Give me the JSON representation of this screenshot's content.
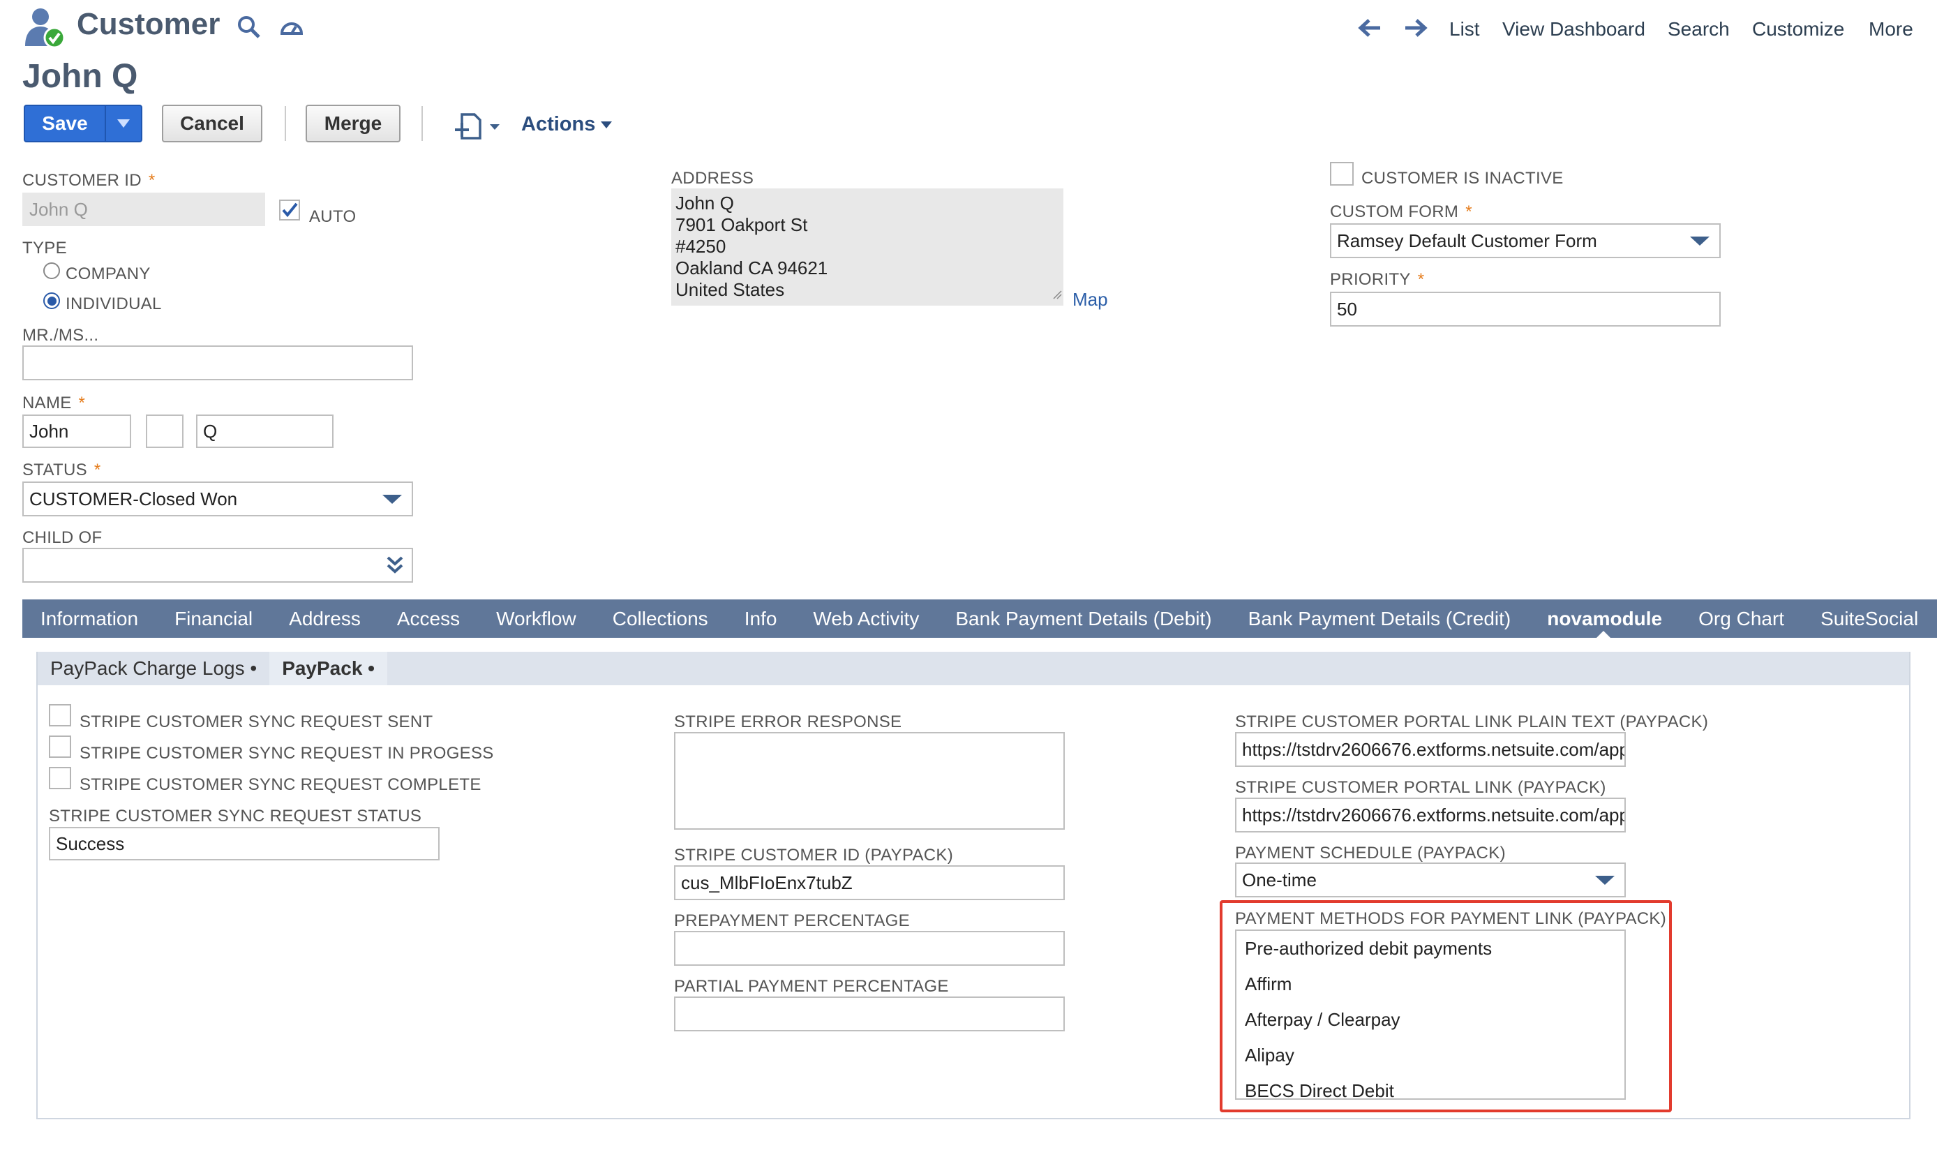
{
  "header": {
    "record_type": "Customer",
    "record_name": "John Q",
    "nav": {
      "list": "List",
      "view_dashboard": "View Dashboard",
      "search": "Search",
      "customize": "Customize",
      "more": "More"
    }
  },
  "toolbar": {
    "save": "Save",
    "cancel": "Cancel",
    "merge": "Merge",
    "actions": "Actions"
  },
  "primary": {
    "customer_id": {
      "label": "CUSTOMER ID",
      "value": "John Q"
    },
    "auto": {
      "label": "AUTO",
      "checked": true
    },
    "type": {
      "label": "TYPE",
      "options": [
        "COMPANY",
        "INDIVIDUAL"
      ],
      "selected": "INDIVIDUAL"
    },
    "salutation": {
      "label": "MR./MS...",
      "value": ""
    },
    "name": {
      "label": "NAME",
      "first": "John",
      "middle": "",
      "last": "Q"
    },
    "status": {
      "label": "STATUS",
      "value": "CUSTOMER-Closed Won"
    },
    "child_of": {
      "label": "CHILD OF",
      "value": ""
    },
    "address": {
      "label": "ADDRESS",
      "lines": [
        "John Q",
        "7901 Oakport St",
        "#4250",
        "Oakland CA 94621",
        "United States"
      ],
      "map_link": "Map"
    },
    "inactive": {
      "label": "CUSTOMER IS INACTIVE",
      "checked": false
    },
    "custom_form": {
      "label": "CUSTOM FORM",
      "value": "Ramsey Default Customer Form"
    },
    "priority": {
      "label": "PRIORITY",
      "value": "50"
    }
  },
  "tabs": [
    "Information",
    "Financial",
    "Address",
    "Access",
    "Workflow",
    "Collections",
    "Info",
    "Web Activity",
    "Bank Payment Details (Debit)",
    "Bank Payment Details (Credit)",
    "novamodule",
    "Org Chart",
    "SuiteSocial"
  ],
  "active_tab": "novamodule",
  "subtabs": [
    "PayPack Charge Logs •",
    "PayPack •"
  ],
  "active_subtab": "PayPack •",
  "paypack": {
    "sync_sent": {
      "label": "STRIPE CUSTOMER SYNC REQUEST SENT",
      "checked": false
    },
    "sync_in_progress": {
      "label": "STRIPE CUSTOMER SYNC REQUEST IN PROGESS",
      "checked": false
    },
    "sync_complete": {
      "label": "STRIPE CUSTOMER SYNC REQUEST COMPLETE",
      "checked": false
    },
    "sync_status": {
      "label": "STRIPE CUSTOMER SYNC REQUEST STATUS",
      "value": "Success"
    },
    "error_response": {
      "label": "STRIPE ERROR RESPONSE",
      "value": ""
    },
    "stripe_customer_id": {
      "label": "STRIPE CUSTOMER ID (PAYPACK)",
      "value": "cus_MlbFIoEnx7tubZ"
    },
    "prepayment_pct": {
      "label": "PREPAYMENT PERCENTAGE",
      "value": ""
    },
    "partial_payment_pct": {
      "label": "PARTIAL PAYMENT PERCENTAGE",
      "value": ""
    },
    "portal_link_plain": {
      "label": "STRIPE CUSTOMER PORTAL LINK PLAIN TEXT (PAYPACK)",
      "value": "https://tstdrv2606676.extforms.netsuite.com/app"
    },
    "portal_link": {
      "label": "STRIPE CUSTOMER PORTAL LINK (PAYPACK)",
      "value": "https://tstdrv2606676.extforms.netsuite.com/app"
    },
    "payment_schedule": {
      "label": "PAYMENT SCHEDULE (PAYPACK)",
      "value": "One-time"
    },
    "payment_methods": {
      "label": "PAYMENT METHODS FOR PAYMENT LINK (PAYPACK)",
      "options": [
        "Pre-authorized debit payments",
        "Affirm",
        "Afterpay / Clearpay",
        "Alipay",
        "BECS Direct Debit"
      ]
    }
  },
  "colors": {
    "tab_bar": "#607799",
    "save_button": "#2f6fd6",
    "highlight_box": "#e23b2e",
    "required_marker": "#e57c1c"
  }
}
